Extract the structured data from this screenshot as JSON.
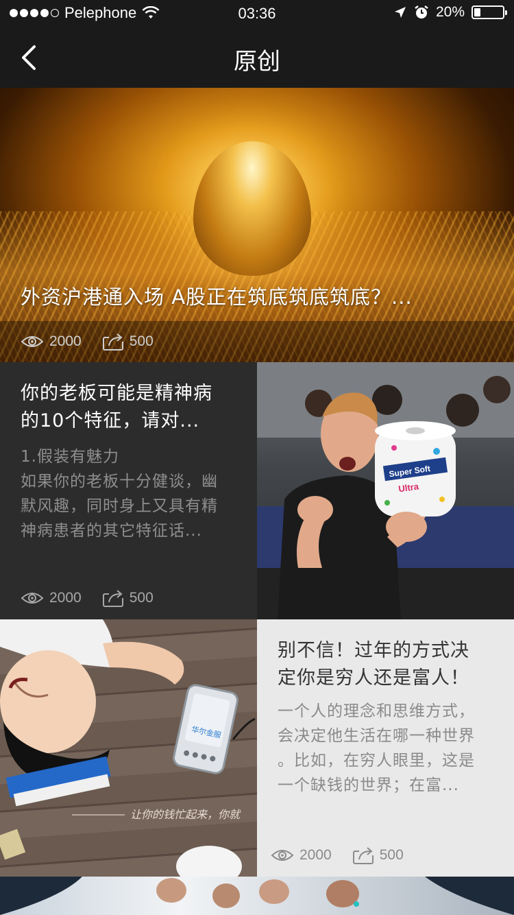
{
  "status_bar": {
    "carrier": "Pelephone",
    "time": "03:36",
    "battery_text": "20%",
    "battery_level": 0.2,
    "signal_bars_filled": 4,
    "signal_bars_total": 5
  },
  "nav": {
    "title": "原创",
    "back_icon": "chevron-left-icon"
  },
  "articles": [
    {
      "title": "外资沪港通入场 A股正在筑底筑底筑底？...",
      "views": "2000",
      "shares": "500",
      "image": "golden egg in nest"
    },
    {
      "title_line1": "你的老板可能是精神病",
      "title_line2": "的10个特征，请对...",
      "excerpt_line1": "1.假装有魅力",
      "excerpt_line2": "如果你的老板十分健谈，幽",
      "excerpt_line3": "默风趣，同时身上又具有精",
      "excerpt_line4": "神病患者的其它特征话...",
      "views": "2000",
      "shares": "500",
      "image": "man holding paper towels"
    },
    {
      "title_line1": "别不信！过年的方式决",
      "title_line2": "定你是穷人还是富人！",
      "excerpt_line1": "一个人的理念和思维方式，",
      "excerpt_line2": "会决定他生活在哪一种世界",
      "excerpt_line3": "。比如，在穷人眼里，这是",
      "excerpt_line4": "一个缺钱的世界；在富...",
      "views": "2000",
      "shares": "500",
      "image_caption": "让你的钱忙起来，你就",
      "device_label": "华尔金服",
      "image": "young man lying on wooden floor with phone"
    }
  ],
  "icons": {
    "views": "eye-icon",
    "shares": "share-icon"
  },
  "colors": {
    "nav_bg": "#1a1a1a",
    "dark_card_bg": "#2c2c2c",
    "light_card_bg": "#e9e9e9"
  }
}
